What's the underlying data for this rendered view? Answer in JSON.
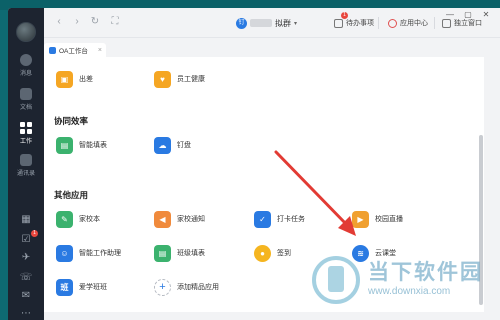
{
  "rail": {
    "items": [
      {
        "label": "消息"
      },
      {
        "label": "文档"
      },
      {
        "label": "工作"
      },
      {
        "label": "通讯录"
      }
    ],
    "badge": "1"
  },
  "topbar": {
    "org_logo": "钉",
    "org_name": "拟群",
    "todo_label": "待办事项",
    "todo_badge": "1",
    "app_center_label": "应用中心",
    "independent_window_label": "独立窗口"
  },
  "tab": {
    "title": "OA工作台",
    "close": "×"
  },
  "sections": {
    "top_apps": [
      {
        "label": "出差",
        "color": "#f5a623",
        "icon": "suitcase-icon",
        "glyph": "▣"
      },
      {
        "label": "员工健康",
        "color": "#f5a623",
        "icon": "health-icon",
        "glyph": "♥"
      }
    ],
    "collab": {
      "title": "协同效率",
      "apps": [
        {
          "label": "智能填表",
          "color": "#3bb26e",
          "icon": "form-icon",
          "glyph": "▤"
        },
        {
          "label": "钉盘",
          "color": "#2a7ae2",
          "icon": "cloud-disk-icon",
          "glyph": "☁"
        }
      ]
    },
    "other": {
      "title": "其他应用",
      "apps": [
        {
          "label": "家校本",
          "color": "#3bb26e",
          "icon": "homework-icon",
          "glyph": "✎"
        },
        {
          "label": "家校通知",
          "color": "#f08a3c",
          "icon": "notice-icon",
          "glyph": "◀"
        },
        {
          "label": "打卡任务",
          "color": "#2a7ae2",
          "icon": "checkin-icon",
          "glyph": "✓"
        },
        {
          "label": "校园直播",
          "color": "#f0a030",
          "icon": "live-icon",
          "glyph": "▶"
        },
        {
          "label": "智能工作助理",
          "color": "#2a7ae2",
          "icon": "assistant-icon",
          "glyph": "☺"
        },
        {
          "label": "班级填表",
          "color": "#3bb26e",
          "icon": "class-form-icon",
          "glyph": "▤"
        },
        {
          "label": "签到",
          "color": "#f5b520",
          "icon": "signin-icon",
          "glyph": "●"
        },
        {
          "label": "云课堂",
          "color": "#2a7ae2",
          "icon": "cloud-class-icon",
          "glyph": "≋"
        },
        {
          "label": "爱学班班",
          "color": "#2a7ae2",
          "icon": "class-icon",
          "glyph": "班"
        },
        {
          "label": "添加精品应用",
          "color": "#ffffff",
          "icon": "add-icon",
          "glyph": "+"
        }
      ]
    }
  },
  "watermark": {
    "text": "当下软件园",
    "url": "www.downxia.com"
  },
  "colors": {
    "rail_bg": "#1d2430",
    "accent": "#2a7ae2",
    "arrow": "#e23b34"
  }
}
